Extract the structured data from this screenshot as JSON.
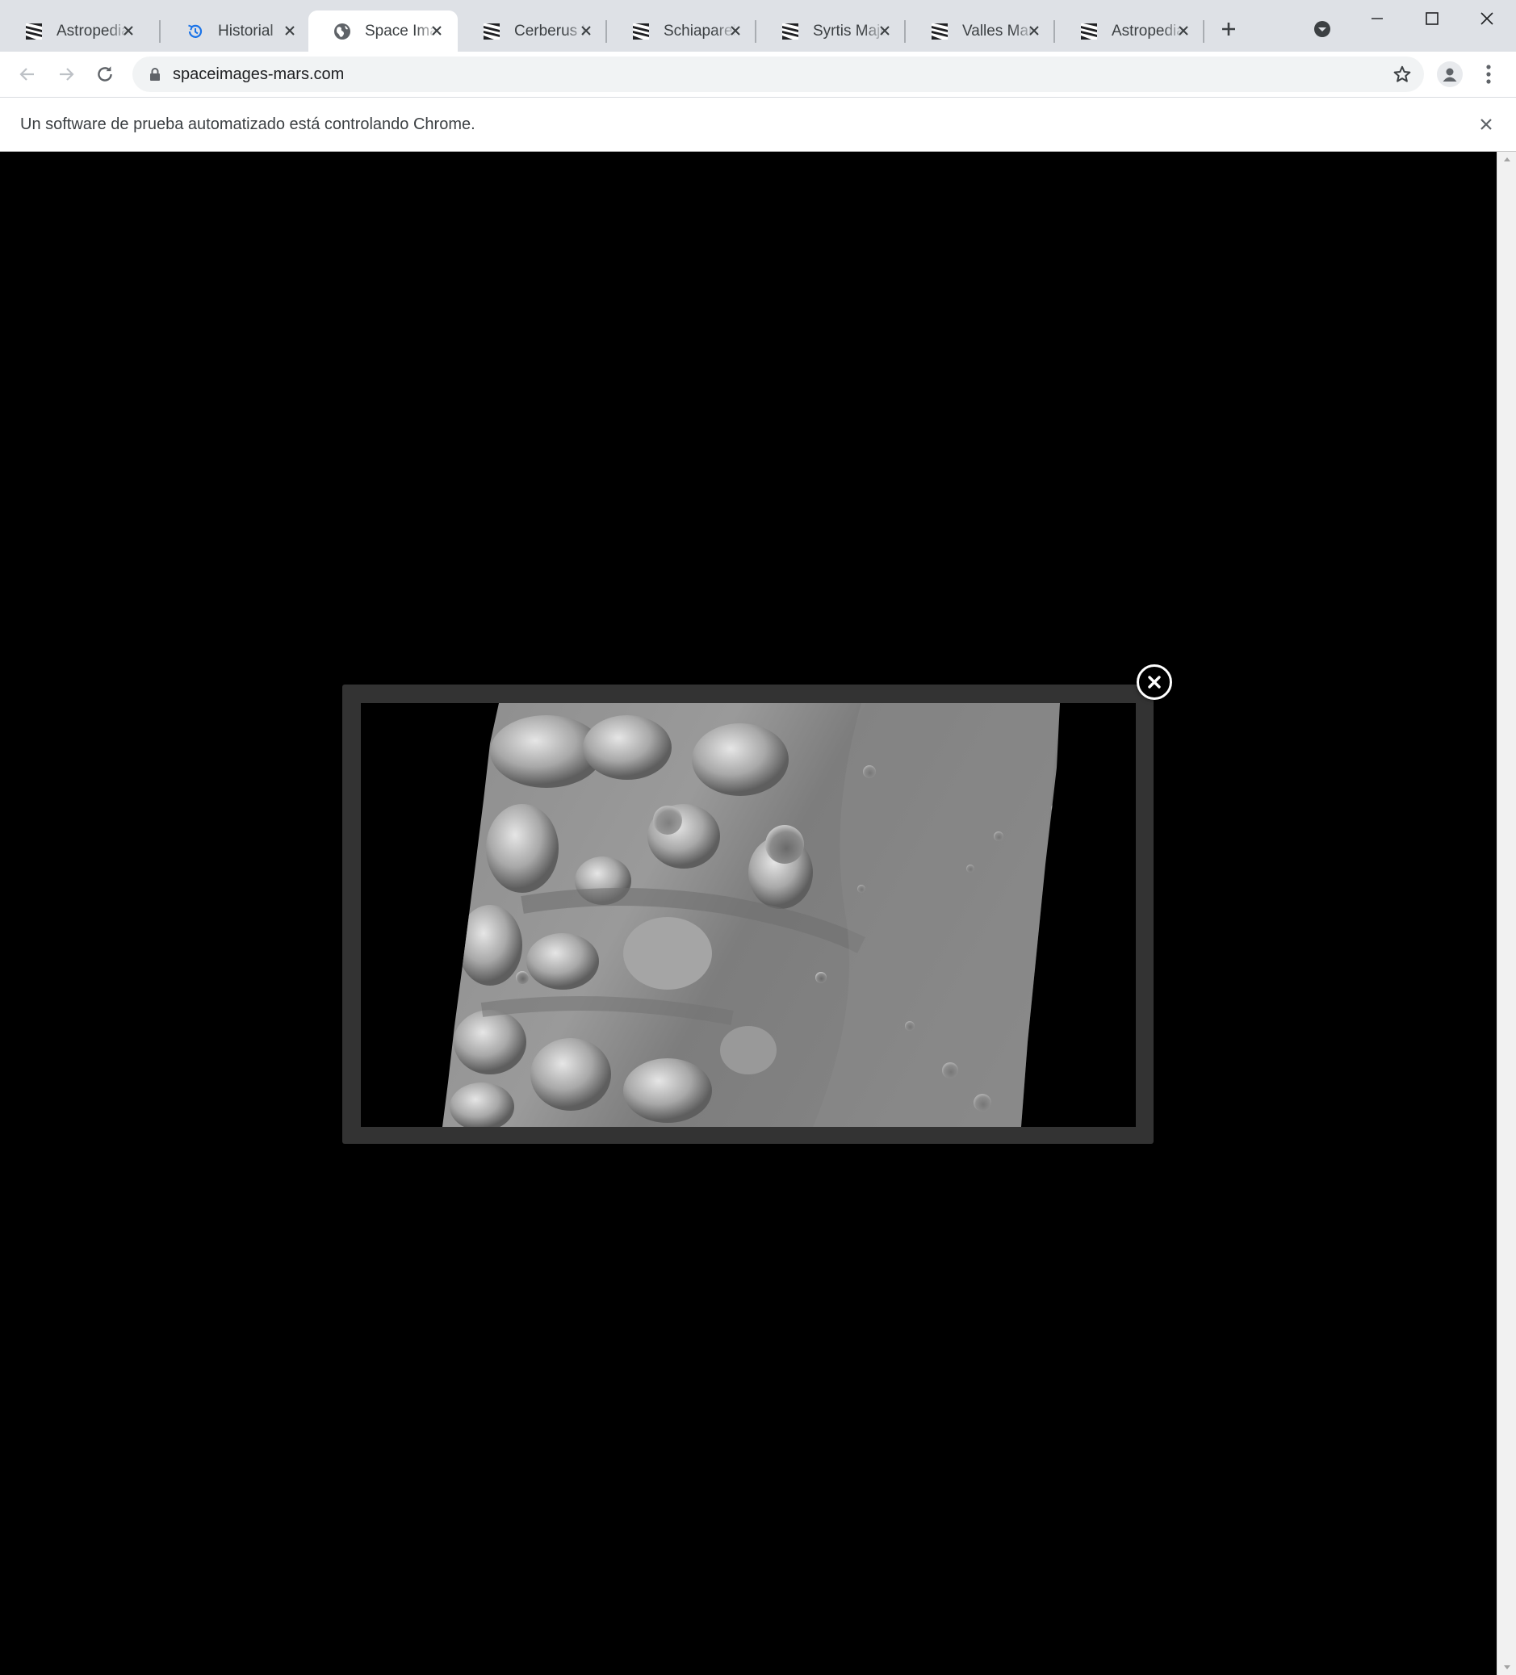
{
  "browser": {
    "tabs": [
      {
        "title": "Astropedia",
        "icon": "astropedia-favicon-icon",
        "active": false
      },
      {
        "title": "Historial",
        "icon": "history-icon",
        "active": false
      },
      {
        "title": "Space Images",
        "icon": "globe-icon",
        "active": true
      },
      {
        "title": "Cerberus Hemisphere",
        "icon": "astropedia-favicon-icon",
        "active": false
      },
      {
        "title": "Schiaparelli Hemisphere",
        "icon": "astropedia-favicon-icon",
        "active": false
      },
      {
        "title": "Syrtis Major Hemisphere",
        "icon": "astropedia-favicon-icon",
        "active": false
      },
      {
        "title": "Valles Marineris Hemisphere",
        "icon": "astropedia-favicon-icon",
        "active": false
      },
      {
        "title": "Astropedia",
        "icon": "astropedia-favicon-icon",
        "active": false
      }
    ],
    "url": "spaceimages-mars.com",
    "infobar_text": "Un software de prueba automatizado está controlando Chrome.",
    "colors": {
      "tabstrip": "#dee1e6",
      "toolbar": "#ffffff",
      "omnibox": "#f1f3f4",
      "history_icon": "#1a73e8",
      "content_background": "#000000",
      "lightbox_frame": "#333333"
    }
  },
  "page": {
    "lightbox": {
      "image_description": "grayscale Mars surface image",
      "close_icon": "close-circle-icon"
    }
  }
}
